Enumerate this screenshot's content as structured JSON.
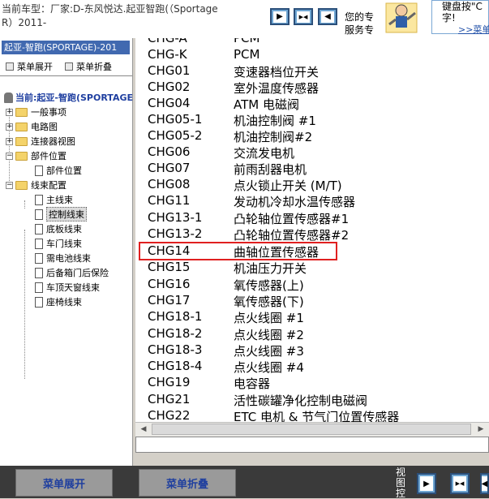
{
  "header": {
    "vehicle_line1": "当前车型：厂家:D-东风悦达.起亚智跑(（Sportage",
    "vehicle_line2": "R）2011-",
    "nav_buttons": [
      {
        "icon": "play-right-icon",
        "glyph": "▶"
      },
      {
        "icon": "split-view-icon",
        "glyph": "▶◀"
      },
      {
        "icon": "play-left-icon",
        "glyph": "◀"
      }
    ],
    "service_line1": "您的专",
    "service_line2": "服务专",
    "ad_line1": "键盘按\"C",
    "ad_line2": "字!",
    "ad_link": ">>菜单"
  },
  "sidebar": {
    "title": "起亚-智跑(SPORTAGE)-201",
    "expand_label": "菜单展开",
    "collapse_label": "菜单折叠",
    "root_label": "当前:起亚-智跑(SPORTAGE",
    "items": [
      {
        "label": "一般事项"
      },
      {
        "label": "电路图"
      },
      {
        "label": "连接器视图"
      },
      {
        "label": "部件位置"
      },
      {
        "label": "部件位置"
      },
      {
        "label": "线束配置"
      },
      {
        "label": "主线束"
      },
      {
        "label": "控制线束"
      },
      {
        "label": "底板线束"
      },
      {
        "label": "车门线束"
      },
      {
        "label": "需电池线束"
      },
      {
        "label": "后备箱门后保险"
      },
      {
        "label": "车顶天窗线束"
      },
      {
        "label": "座椅线束"
      }
    ]
  },
  "connectors": [
    {
      "code": "CHG-A",
      "desc": "PCM"
    },
    {
      "code": "CHG-K",
      "desc": "PCM"
    },
    {
      "code": "CHG01",
      "desc": "变速器档位开关"
    },
    {
      "code": "CHG02",
      "desc": "室外温度传感器"
    },
    {
      "code": "CHG04",
      "desc": "ATM 电磁阀"
    },
    {
      "code": "CHG05-1",
      "desc": "机油控制阀 #1"
    },
    {
      "code": "CHG05-2",
      "desc": "机油控制阀#2"
    },
    {
      "code": "CHG06",
      "desc": "交流发电机"
    },
    {
      "code": "CHG07",
      "desc": "前雨刮器电机"
    },
    {
      "code": "CHG08",
      "desc": "点火锁止开关 (M/T)"
    },
    {
      "code": "CHG11",
      "desc": "发动机冷却水温传感器"
    },
    {
      "code": "CHG13-1",
      "desc": "凸轮轴位置传感器#1"
    },
    {
      "code": "CHG13-2",
      "desc": "凸轮轴位置传感器#2"
    },
    {
      "code": "CHG14",
      "desc": "曲轴位置传感器"
    },
    {
      "code": "CHG15",
      "desc": "机油压力开关"
    },
    {
      "code": "CHG16",
      "desc": "氧传感器(上)"
    },
    {
      "code": "CHG17",
      "desc": "氧传感器(下)"
    },
    {
      "code": "CHG18-1",
      "desc": "点火线圈 #1"
    },
    {
      "code": "CHG18-2",
      "desc": "点火线圈 #2"
    },
    {
      "code": "CHG18-3",
      "desc": "点火线圈 #3"
    },
    {
      "code": "CHG18-4",
      "desc": "点火线圈 #4"
    },
    {
      "code": "CHG19",
      "desc": "电容器"
    },
    {
      "code": "CHG21",
      "desc": "活性碳罐净化控制电磁阀"
    },
    {
      "code": "CHG22",
      "desc": "ETC 电机 & 节气门位置传感器"
    }
  ],
  "colors": {
    "highlight": "#e02020",
    "sidebar_header": "#4169b0",
    "bottom_button_text": "#1f3f9f"
  },
  "footer": {
    "expand_label": "菜单展开",
    "collapse_label": "菜单折叠",
    "view_label": "视图控",
    "nav_buttons": [
      {
        "icon": "play-right-icon",
        "glyph": "▶"
      },
      {
        "icon": "split-view-icon",
        "glyph": "▶◀"
      },
      {
        "icon": "play-left-icon",
        "glyph": "◀"
      }
    ]
  }
}
